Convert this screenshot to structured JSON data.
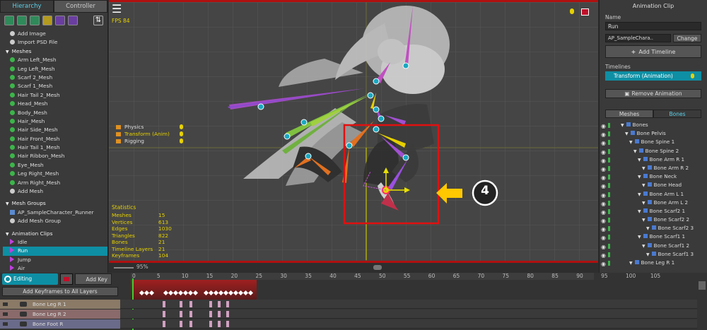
{
  "left": {
    "tabs": [
      "Hierarchy",
      "Controller"
    ],
    "actions": [
      "Add Image",
      "Import PSD File"
    ],
    "meshes_header": "Meshes",
    "meshes": [
      "Arm Left_Mesh",
      "Leg Left_Mesh",
      "Scarf 2_Mesh",
      "Scarf 1_Mesh",
      "Hair Tail 2_Mesh",
      "Head_Mesh",
      "Body_Mesh",
      "Hair_Mesh",
      "Hair Side_Mesh",
      "Hair Front_Mesh",
      "Hair Tail 1_Mesh",
      "Hair Ribbon_Mesh",
      "Eye_Mesh",
      "Leg Right_Mesh",
      "Arm Right_Mesh"
    ],
    "add_mesh": "Add Mesh",
    "groups_header": "Mesh Groups",
    "groups": [
      "AP_SampleCharacter_Runner"
    ],
    "add_group": "Add Mesh Group",
    "clips_header": "Animation Clips",
    "clips": [
      "Idle",
      "Run",
      "Jump",
      "Air"
    ],
    "selected_clip": "Run"
  },
  "viewport": {
    "fps": "FPS 84",
    "layers": [
      "Physics",
      "Transform (Anim)",
      "Rigging"
    ],
    "callout": "4",
    "zoom": "95%",
    "stats_title": "Statistics",
    "stats": [
      [
        "Meshes",
        "15"
      ],
      [
        "Vertices",
        "613"
      ],
      [
        "Edges",
        "1030"
      ],
      [
        "Triangles",
        "822"
      ],
      [
        "Bones",
        "21"
      ],
      [
        "Timeline Layers",
        "21"
      ],
      [
        "Keyframes",
        "104"
      ]
    ]
  },
  "right": {
    "title": "Animation Clip",
    "name_label": "Name",
    "name_value": "Run",
    "target": "AP_SampleChara..",
    "change": "Change",
    "add_timeline": "Add Timeline",
    "timelines_label": "Timelines",
    "timeline": "Transform (Animation)",
    "remove": "Remove Animation",
    "tabs": [
      "Meshes",
      "Bones"
    ],
    "bones": [
      [
        "Bones",
        0
      ],
      [
        "Bone Pelvis",
        1
      ],
      [
        "Bone Spine 1",
        2
      ],
      [
        "Bone Spine 2",
        3
      ],
      [
        "Bone Arm R 1",
        4
      ],
      [
        "Bone Arm R 2",
        5
      ],
      [
        "Bone Neck",
        4
      ],
      [
        "Bone Head",
        5
      ],
      [
        "Bone Arm L 1",
        4
      ],
      [
        "Bone Arm L 2",
        5
      ],
      [
        "Bone Scarf2 1",
        4
      ],
      [
        "Bone Scarf2 2",
        5
      ],
      [
        "Bone Scarf2 3",
        6
      ],
      [
        "Bone Scarf1 1",
        4
      ],
      [
        "Bone Scarf1 2",
        5
      ],
      [
        "Bone Scarf1 3",
        6
      ],
      [
        "Bone Leg R 1",
        2
      ]
    ]
  },
  "timeline": {
    "editing": "Editing",
    "add_key": "Add Key",
    "add_all": "Add Keyframes to All Layers",
    "ticks": [
      "0",
      "5",
      "10",
      "15",
      "20",
      "25",
      "30",
      "35",
      "40",
      "45",
      "50",
      "55",
      "60",
      "65",
      "70",
      "75",
      "80",
      "85",
      "90",
      "95",
      "100",
      "105"
    ],
    "layers": [
      "Bone Leg R 1",
      "Bone Leg R 2",
      "Bone Foot R"
    ]
  }
}
